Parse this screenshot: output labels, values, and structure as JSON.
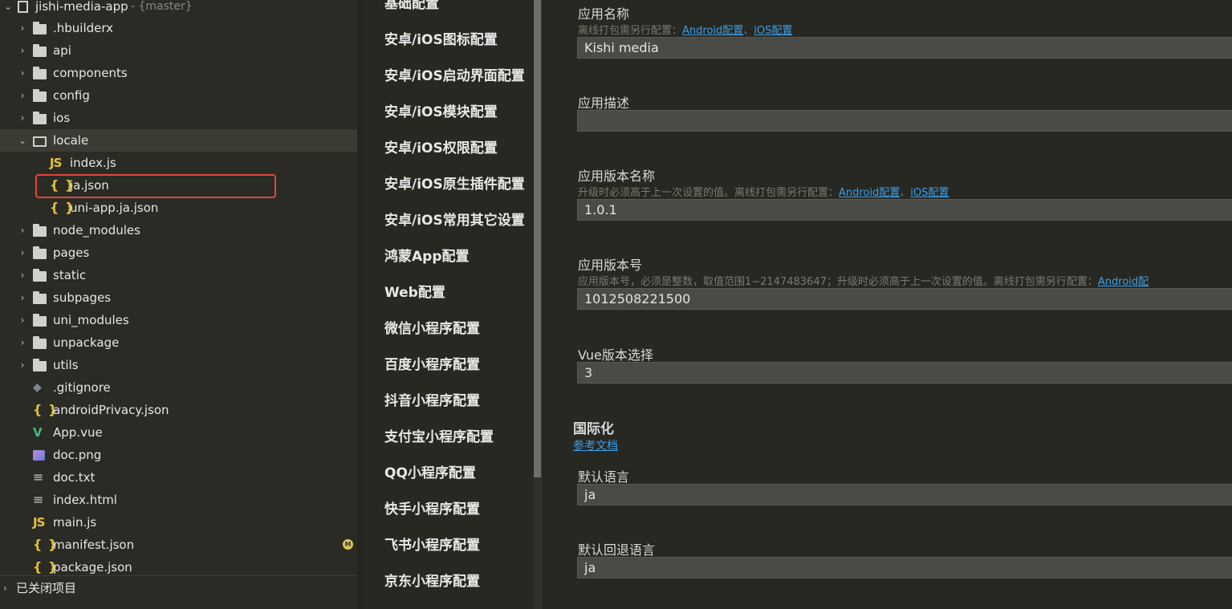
{
  "file_tree": {
    "project_name": "jishi-media-app",
    "branch": "- {master}",
    "items": [
      {
        "label": ".hbuilderx",
        "type": "folder"
      },
      {
        "label": "api",
        "type": "folder"
      },
      {
        "label": "components",
        "type": "folder"
      },
      {
        "label": "config",
        "type": "folder"
      },
      {
        "label": "ios",
        "type": "folder"
      },
      {
        "label": "locale",
        "type": "folder-open"
      },
      {
        "label": "index.js",
        "type": "js"
      },
      {
        "label": "ja.json",
        "type": "json"
      },
      {
        "label": "uni-app.ja.json",
        "type": "json"
      },
      {
        "label": "node_modules",
        "type": "folder"
      },
      {
        "label": "pages",
        "type": "folder"
      },
      {
        "label": "static",
        "type": "folder"
      },
      {
        "label": "subpages",
        "type": "folder"
      },
      {
        "label": "uni_modules",
        "type": "folder"
      },
      {
        "label": "unpackage",
        "type": "folder"
      },
      {
        "label": "utils",
        "type": "folder"
      },
      {
        "label": ".gitignore",
        "type": "git"
      },
      {
        "label": "androidPrivacy.json",
        "type": "json"
      },
      {
        "label": "App.vue",
        "type": "vue"
      },
      {
        "label": "doc.png",
        "type": "image"
      },
      {
        "label": "doc.txt",
        "type": "text"
      },
      {
        "label": "index.html",
        "type": "text"
      },
      {
        "label": "main.js",
        "type": "js"
      },
      {
        "label": "manifest.json",
        "type": "json",
        "badge": "M"
      },
      {
        "label": "package.json",
        "type": "json"
      }
    ],
    "closed_projects_label": "已关闭项目"
  },
  "config_nav": {
    "items": [
      "基础配置",
      "安卓/iOS图标配置",
      "安卓/iOS启动界面配置",
      "安卓/iOS模块配置",
      "安卓/iOS权限配置",
      "安卓/iOS原生插件配置",
      "安卓/iOS常用其它设置",
      "鸿蒙App配置",
      "Web配置",
      "微信小程序配置",
      "百度小程序配置",
      "抖音小程序配置",
      "支付宝小程序配置",
      "QQ小程序配置",
      "快手小程序配置",
      "飞书小程序配置",
      "京东小程序配置"
    ]
  },
  "form": {
    "app_name": {
      "label": "应用名称",
      "hint": "离线打包需另行配置：",
      "link_android": "Android配置",
      "sep": "、",
      "link_ios": "iOS配置",
      "value": "Kishi media"
    },
    "app_desc": {
      "label": "应用描述",
      "value": ""
    },
    "version_name": {
      "label": "应用版本名称",
      "hint": "升级时必须高于上一次设置的值。离线打包需另行配置：",
      "link_android": "Android配置",
      "sep": "、",
      "link_ios": "iOS配置",
      "value": "1.0.1"
    },
    "version_code": {
      "label": "应用版本号",
      "hint": "应用版本号，必须是整数，取值范围1~2147483647；升级时必须高于上一次设置的值。离线打包需另行配置：",
      "link_android": "Android配",
      "value": "1012508221500"
    },
    "vue_version": {
      "label": "Vue版本选择",
      "value": "3"
    },
    "i18n": {
      "title": "国际化",
      "doc_link": "参考文档"
    },
    "default_locale": {
      "label": "默认语言",
      "value": "ja"
    },
    "fallback_locale": {
      "label": "默认回退语言",
      "value": "ja"
    }
  },
  "colors": {
    "background": "#272822",
    "link": "#3d9ee8",
    "highlight": "#e0463a",
    "json_icon": "#e5c13b",
    "vue_icon": "#42b883"
  }
}
